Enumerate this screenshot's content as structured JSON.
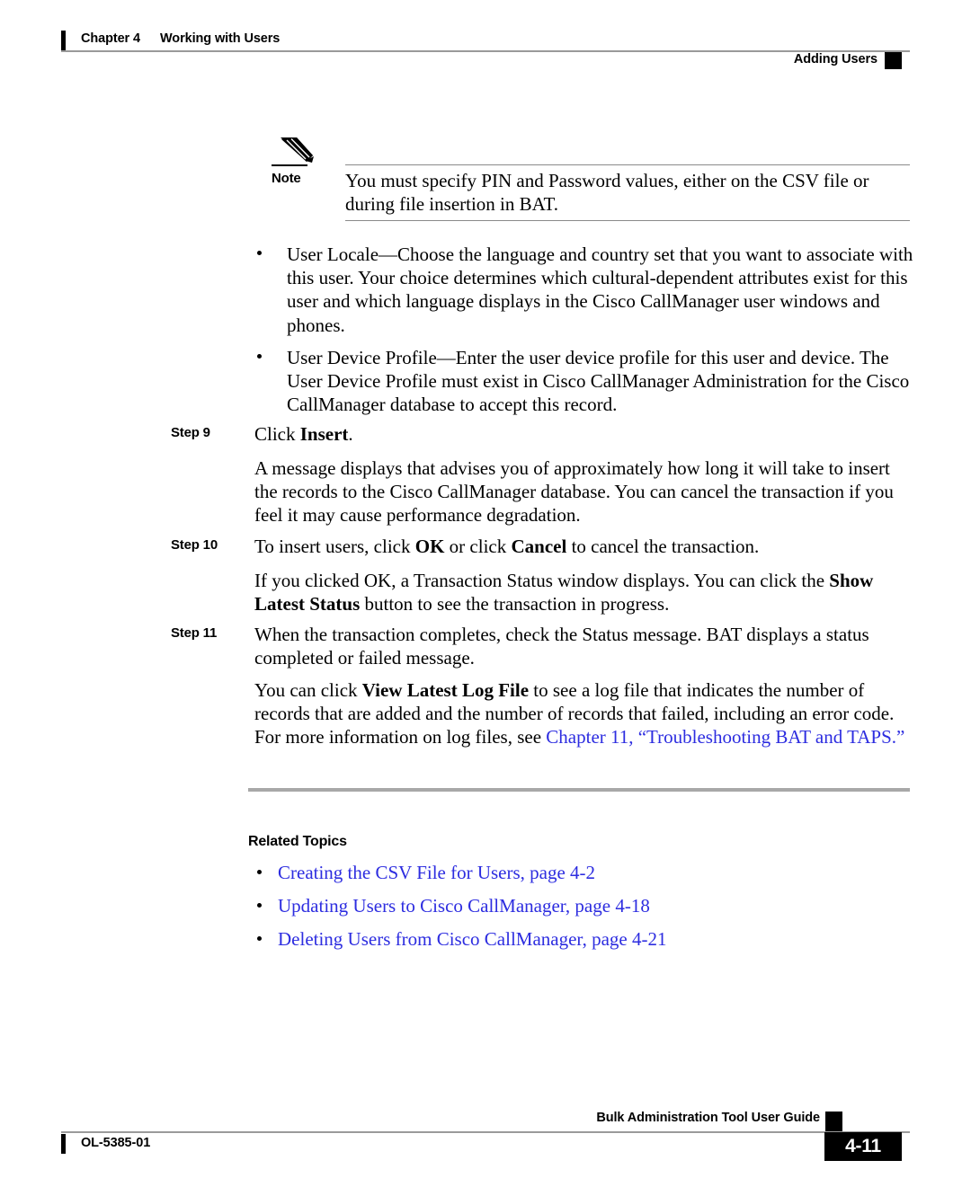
{
  "header": {
    "chapter": "Chapter 4",
    "chapter_title": "Working with Users",
    "section_title": "Adding Users"
  },
  "note": {
    "icon": "pencil-icon",
    "label": "Note",
    "text": "You must specify PIN and Password values, either on the CSV file or during file insertion in BAT."
  },
  "bullets": [
    {
      "term": "User Locale",
      "text": "User Locale—Choose the language and country set that you want to associate with this user. Your choice determines which cultural-dependent attributes exist for this user and which language displays in the Cisco CallManager user windows and phones."
    },
    {
      "term": "User Device Profile",
      "text": "User Device Profile—Enter the user device profile for this user and device. The User Device Profile must exist in Cisco CallManager Administration for the Cisco CallManager database to accept this record."
    }
  ],
  "steps": [
    {
      "label": "Step 9",
      "lead_prefix": "Click ",
      "lead_bold": "Insert",
      "lead_suffix": ".",
      "body": "A message displays that advises you of approximately how long it will take to insert the records to the Cisco CallManager database. You can cancel the transaction if you feel it may cause performance degradation."
    },
    {
      "label": "Step 10",
      "lead_prefix": "To insert users, click ",
      "lead_bold": "OK",
      "lead_mid": " or click ",
      "lead_bold2": "Cancel",
      "lead_suffix": " to cancel the transaction.",
      "body_prefix": "If you clicked OK, a Transaction Status window displays. You can click the ",
      "body_bold": "Show Latest Status",
      "body_suffix": " button to see the transaction in progress."
    },
    {
      "label": "Step 11",
      "lead": "When the transaction completes, check the Status message. BAT displays a status completed or failed message.",
      "body_prefix": "You can click ",
      "body_bold": "View Latest Log File",
      "body_mid": " to see a log file that indicates the number of records that are added and the number of records that failed, including an error code. For more information on log files, see ",
      "body_link": "Chapter 11, “Troubleshooting BAT and TAPS.”"
    }
  ],
  "related": {
    "heading": "Related Topics",
    "links": [
      "Creating the CSV File for Users, page 4-2",
      "Updating Users to Cisco CallManager, page 4-18",
      "Deleting Users from Cisco CallManager, page 4-21"
    ]
  },
  "footer": {
    "doc_id": "OL-5385-01",
    "guide_title": "Bulk Administration Tool User Guide",
    "page_number": "4-11"
  },
  "colors": {
    "link": "#2d2de0",
    "rule": "#9a9a9a",
    "section_rule": "#a8a8a8",
    "tab": "#000000"
  }
}
